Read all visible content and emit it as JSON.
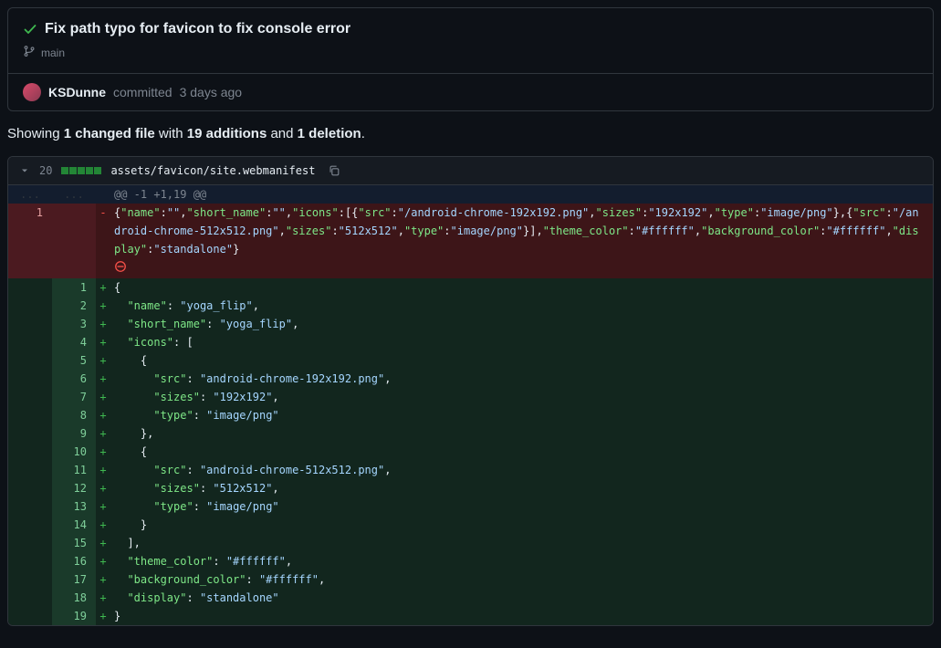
{
  "commit": {
    "title": "Fix path typo for favicon to fix console error",
    "branch": "main",
    "author": "KSDunne",
    "committed_verb": "committed",
    "relative_time": "3 days ago"
  },
  "summary": {
    "prefix": "Showing ",
    "files": "1 changed file",
    "with": " with ",
    "adds": "19 additions",
    "and": " and ",
    "dels": "1 deletion",
    "suffix": "."
  },
  "file": {
    "change_count": "20",
    "path": "assets/favicon/site.webmanifest",
    "hunk_header": "@@ -1 +1,19 @@",
    "hunk_dots": "...",
    "deleted_old_lineno": "1",
    "deleted_code": "{\"name\":\"\",\"short_name\":\"\",\"icons\":[{\"src\":\"/android-chrome-192x192.png\",\"sizes\":\"192x192\",\"type\":\"image/png\"},{\"src\":\"/android-chrome-512x512.png\",\"sizes\":\"512x512\",\"type\":\"image/png\"}],\"theme_color\":\"#ffffff\",\"background_color\":\"#ffffff\",\"display\":\"standalone\"}",
    "added": [
      {
        "n": "1",
        "tokens": [
          {
            "t": "{",
            "c": "punc"
          }
        ]
      },
      {
        "n": "2",
        "tokens": [
          {
            "t": "  ",
            "c": "punc"
          },
          {
            "t": "\"name\"",
            "c": "key"
          },
          {
            "t": ": ",
            "c": "punc"
          },
          {
            "t": "\"yoga_flip\"",
            "c": "str"
          },
          {
            "t": ",",
            "c": "punc"
          }
        ]
      },
      {
        "n": "3",
        "tokens": [
          {
            "t": "  ",
            "c": "punc"
          },
          {
            "t": "\"short_name\"",
            "c": "key"
          },
          {
            "t": ": ",
            "c": "punc"
          },
          {
            "t": "\"yoga_flip\"",
            "c": "str"
          },
          {
            "t": ",",
            "c": "punc"
          }
        ]
      },
      {
        "n": "4",
        "tokens": [
          {
            "t": "  ",
            "c": "punc"
          },
          {
            "t": "\"icons\"",
            "c": "key"
          },
          {
            "t": ": [",
            "c": "punc"
          }
        ]
      },
      {
        "n": "5",
        "tokens": [
          {
            "t": "    {",
            "c": "punc"
          }
        ]
      },
      {
        "n": "6",
        "tokens": [
          {
            "t": "      ",
            "c": "punc"
          },
          {
            "t": "\"src\"",
            "c": "key"
          },
          {
            "t": ": ",
            "c": "punc"
          },
          {
            "t": "\"android-chrome-192x192.png\"",
            "c": "str"
          },
          {
            "t": ",",
            "c": "punc"
          }
        ]
      },
      {
        "n": "7",
        "tokens": [
          {
            "t": "      ",
            "c": "punc"
          },
          {
            "t": "\"sizes\"",
            "c": "key"
          },
          {
            "t": ": ",
            "c": "punc"
          },
          {
            "t": "\"192x192\"",
            "c": "str"
          },
          {
            "t": ",",
            "c": "punc"
          }
        ]
      },
      {
        "n": "8",
        "tokens": [
          {
            "t": "      ",
            "c": "punc"
          },
          {
            "t": "\"type\"",
            "c": "key"
          },
          {
            "t": ": ",
            "c": "punc"
          },
          {
            "t": "\"image/png\"",
            "c": "str"
          }
        ]
      },
      {
        "n": "9",
        "tokens": [
          {
            "t": "    },",
            "c": "punc"
          }
        ]
      },
      {
        "n": "10",
        "tokens": [
          {
            "t": "    {",
            "c": "punc"
          }
        ]
      },
      {
        "n": "11",
        "tokens": [
          {
            "t": "      ",
            "c": "punc"
          },
          {
            "t": "\"src\"",
            "c": "key"
          },
          {
            "t": ": ",
            "c": "punc"
          },
          {
            "t": "\"android-chrome-512x512.png\"",
            "c": "str"
          },
          {
            "t": ",",
            "c": "punc"
          }
        ]
      },
      {
        "n": "12",
        "tokens": [
          {
            "t": "      ",
            "c": "punc"
          },
          {
            "t": "\"sizes\"",
            "c": "key"
          },
          {
            "t": ": ",
            "c": "punc"
          },
          {
            "t": "\"512x512\"",
            "c": "str"
          },
          {
            "t": ",",
            "c": "punc"
          }
        ]
      },
      {
        "n": "13",
        "tokens": [
          {
            "t": "      ",
            "c": "punc"
          },
          {
            "t": "\"type\"",
            "c": "key"
          },
          {
            "t": ": ",
            "c": "punc"
          },
          {
            "t": "\"image/png\"",
            "c": "str"
          }
        ]
      },
      {
        "n": "14",
        "tokens": [
          {
            "t": "    }",
            "c": "punc"
          }
        ]
      },
      {
        "n": "15",
        "tokens": [
          {
            "t": "  ],",
            "c": "punc"
          }
        ]
      },
      {
        "n": "16",
        "tokens": [
          {
            "t": "  ",
            "c": "punc"
          },
          {
            "t": "\"theme_color\"",
            "c": "key"
          },
          {
            "t": ": ",
            "c": "punc"
          },
          {
            "t": "\"#ffffff\"",
            "c": "str"
          },
          {
            "t": ",",
            "c": "punc"
          }
        ]
      },
      {
        "n": "17",
        "tokens": [
          {
            "t": "  ",
            "c": "punc"
          },
          {
            "t": "\"background_color\"",
            "c": "key"
          },
          {
            "t": ": ",
            "c": "punc"
          },
          {
            "t": "\"#ffffff\"",
            "c": "str"
          },
          {
            "t": ",",
            "c": "punc"
          }
        ]
      },
      {
        "n": "18",
        "tokens": [
          {
            "t": "  ",
            "c": "punc"
          },
          {
            "t": "\"display\"",
            "c": "key"
          },
          {
            "t": ": ",
            "c": "punc"
          },
          {
            "t": "\"standalone\"",
            "c": "str"
          }
        ]
      },
      {
        "n": "19",
        "tokens": [
          {
            "t": "}",
            "c": "punc"
          }
        ]
      }
    ]
  }
}
